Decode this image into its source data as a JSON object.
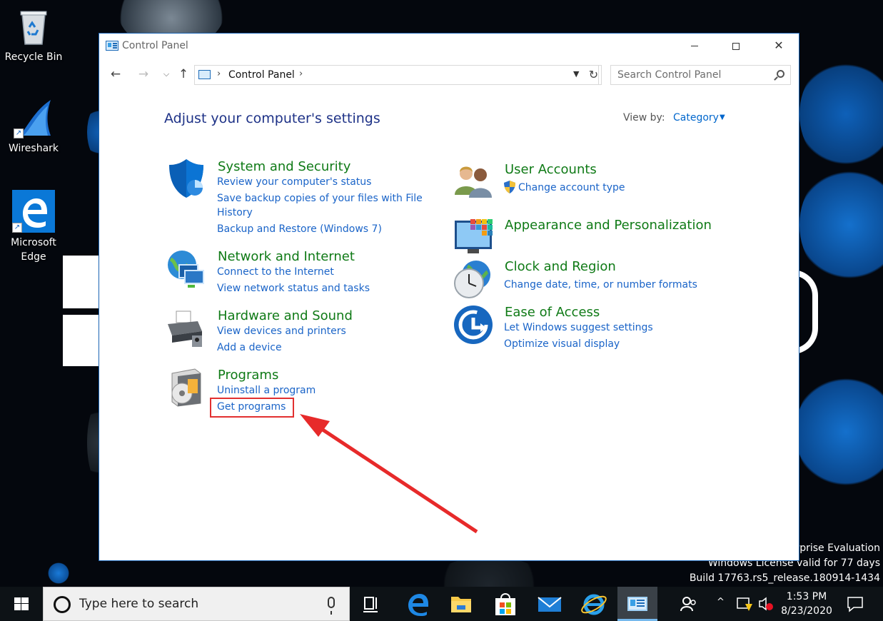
{
  "desktop": {
    "icons": [
      {
        "label": "Recycle Bin",
        "icon": "recycle-bin-icon"
      },
      {
        "label": "Wireshark",
        "icon": "wireshark-icon"
      },
      {
        "label": "Microsoft Edge",
        "icon": "edge-icon"
      }
    ],
    "watermark": {
      "line1": "erprise Evaluation",
      "line2": "Windows License valid for 77 days",
      "line3": "Build 17763.rs5_release.180914-1434"
    }
  },
  "window": {
    "title": "Control Panel",
    "address": {
      "crumb": "Control Panel"
    },
    "search": {
      "placeholder": "Search Control Panel"
    },
    "heading": "Adjust your computer's settings",
    "view_by": {
      "label": "View by:",
      "value": "Category"
    },
    "categories": [
      {
        "title": "System and Security",
        "icon": "shield-icon",
        "links": [
          "Review your computer's status",
          "Save backup copies of your files with File",
          "History",
          "Backup and Restore (Windows 7)"
        ]
      },
      {
        "title": "Network and Internet",
        "icon": "network-globe-icon",
        "links": [
          "Connect to the Internet",
          "View network status and tasks"
        ]
      },
      {
        "title": "Hardware and Sound",
        "icon": "printer-icon",
        "links": [
          "View devices and printers",
          "Add a device"
        ]
      },
      {
        "title": "Programs",
        "icon": "programs-disc-icon",
        "links": [
          "Uninstall a program",
          "Get programs"
        ]
      },
      {
        "title": "User Accounts",
        "icon": "users-icon",
        "links": [
          "Change account type"
        ]
      },
      {
        "title": "Appearance and Personalization",
        "icon": "monitor-palette-icon",
        "links": []
      },
      {
        "title": "Clock and Region",
        "icon": "clock-globe-icon",
        "links": [
          "Change date, time, or number formats"
        ]
      },
      {
        "title": "Ease of Access",
        "icon": "ease-of-access-icon",
        "links": [
          "Let Windows suggest settings",
          "Optimize visual display"
        ]
      }
    ]
  },
  "annotation": {
    "highlight_color": "#e23030"
  },
  "taskbar": {
    "search_placeholder": "Type here to search",
    "apps": [
      "task-view-icon",
      "edge-icon",
      "file-explorer-icon",
      "store-icon",
      "mail-icon",
      "internet-explorer-icon",
      "control-panel-icon"
    ],
    "clock": {
      "time": "1:53 PM",
      "date": "8/23/2020"
    }
  },
  "colors": {
    "link": "#1a64c8",
    "category_title": "#0f7a16",
    "heading": "#1e3287",
    "taskbar": "#0d1216"
  }
}
